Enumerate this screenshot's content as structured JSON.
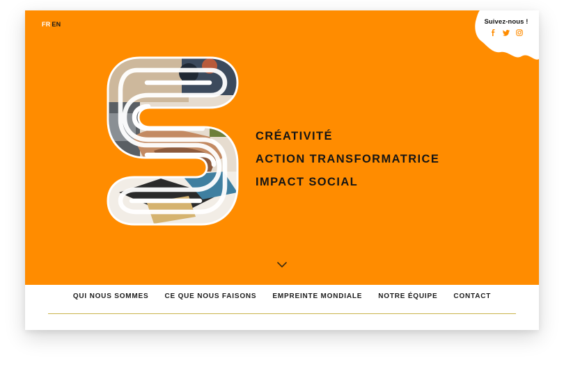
{
  "language_switch": {
    "fr": "FR",
    "en": "EN",
    "active": "FR"
  },
  "social": {
    "title": "Suivez-nous !",
    "icons": [
      "facebook-icon",
      "twitter-icon",
      "instagram-icon"
    ]
  },
  "hero": {
    "background_color": "#ff8c00",
    "taglines": [
      "CRÉATIVITÉ",
      "ACTION TRANSFORMATRICE",
      "IMPACT SOCIAL"
    ],
    "scroll_icon": "chevron-down-icon"
  },
  "nav": {
    "items": [
      "QUI NOUS SOMMES",
      "CE QUE NOUS FAISONS",
      "EMPREINTE MONDIALE",
      "NOTRE ÉQUIPE",
      "CONTACT"
    ]
  },
  "colors": {
    "accent": "#ff8c00",
    "text": "#151515",
    "rule": "#c9b24a"
  }
}
